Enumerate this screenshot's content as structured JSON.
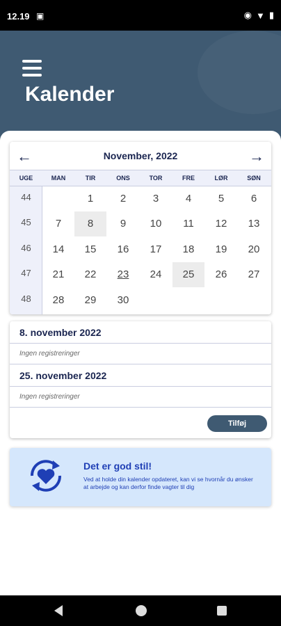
{
  "status": {
    "time": "12.19",
    "left_icon": "sim-icon",
    "right_icons": [
      "eye-icon",
      "wifi-icon",
      "battery-icon"
    ]
  },
  "header": {
    "title": "Kalender",
    "menu_icon": "hamburger-menu-icon"
  },
  "calendar": {
    "month_title": "November, 2022",
    "weekdays": [
      "UGE",
      "MAN",
      "TIR",
      "ONS",
      "TOR",
      "FRE",
      "LØR",
      "SØN"
    ],
    "weeks": [
      {
        "week": "44",
        "days": [
          "",
          "1",
          "2",
          "3",
          "4",
          "5",
          "6"
        ]
      },
      {
        "week": "45",
        "days": [
          "7",
          "8",
          "9",
          "10",
          "11",
          "12",
          "13"
        ]
      },
      {
        "week": "46",
        "days": [
          "14",
          "15",
          "16",
          "17",
          "18",
          "19",
          "20"
        ]
      },
      {
        "week": "47",
        "days": [
          "21",
          "22",
          "23",
          "24",
          "25",
          "26",
          "27"
        ]
      },
      {
        "week": "48",
        "days": [
          "28",
          "29",
          "30",
          "",
          "",
          "",
          ""
        ]
      }
    ],
    "highlighted_days": [
      "8",
      "25"
    ],
    "today": "23"
  },
  "events": [
    {
      "date": "8. november 2022",
      "empty": "Ingen registreringer"
    },
    {
      "date": "25. november 2022",
      "empty": "Ingen registreringer"
    }
  ],
  "add_button": "Tilføj",
  "info": {
    "title": "Det er god stil!",
    "text": "Ved at holde din kalender opdateret, kan vi se hvornår du ønsker at arbejde og kan derfor finde vagter til dig",
    "icon": "heart-sync-icon"
  },
  "colors": {
    "header_bg": "#3f5a72",
    "navy_text": "#1a2550",
    "info_bg": "#d5e7fc",
    "info_text": "#1f3fb5"
  }
}
